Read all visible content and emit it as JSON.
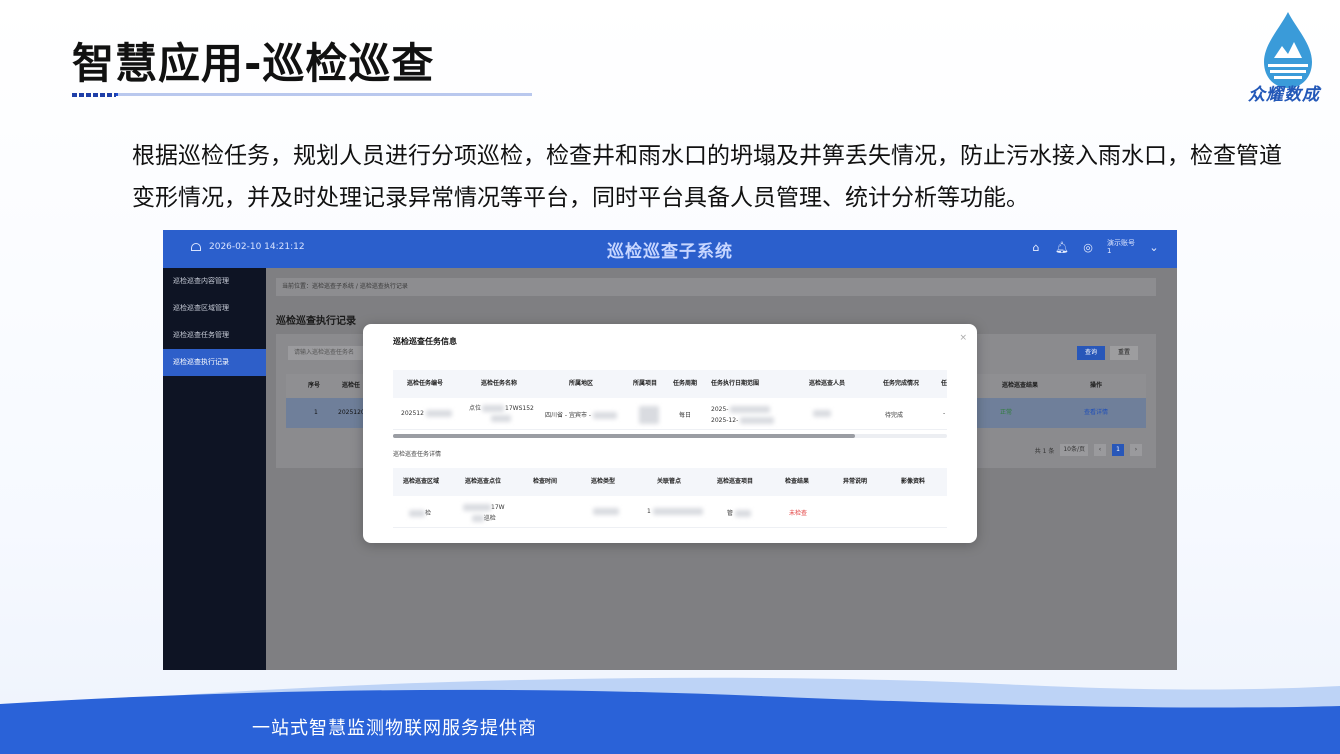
{
  "slide": {
    "title": "智慧应用-巡检巡查",
    "logo_text": "众耀数成",
    "description": "根据巡检任务，规划人员进行分项巡检，检查井和雨水口的坍塌及井箅丢失情况，防止污水接入雨水口，检查管道变形情况，并及时处理记录异常情况等平台，同时平台具备人员管理、统计分析等功能。",
    "footer": "一站式智慧监测物联网服务提供商"
  },
  "app": {
    "header": {
      "datetime": "2026-02-10 14:21:12",
      "title": "巡检巡查子系统",
      "user_name": "演示账号",
      "user_sub": "1",
      "icons": [
        "home-icon",
        "bell-icon",
        "user-avatar-icon",
        "chevron-down-icon"
      ]
    },
    "sidebar": {
      "items": [
        {
          "label": "巡检巡查内容管理"
        },
        {
          "label": "巡检巡查区域管理"
        },
        {
          "label": "巡检巡查任务管理"
        },
        {
          "label": "巡检巡查执行记录"
        }
      ]
    },
    "breadcrumb": "当前位置：巡检巡查子系统 / 巡检巡查执行记录",
    "page_title": "巡检巡查执行记录",
    "search_placeholder": "请输入巡检巡查任务名",
    "query_button": "查询",
    "reset_button": "重置",
    "table": {
      "columns": [
        "序号",
        "巡检任",
        "巡检巡查结果",
        "操作"
      ],
      "row": {
        "index": "1",
        "code": "2025120",
        "result": "正常",
        "action": "查看详情"
      }
    },
    "pager": {
      "total": "共 1 条",
      "page_size": "10条/页",
      "prev": "‹",
      "page": "1",
      "next": "›"
    },
    "modal": {
      "title": "巡检巡查任务信息",
      "close": "×",
      "info_columns": [
        "巡检任务编号",
        "巡检任务名称",
        "所属地区",
        "所属项目",
        "任务周期",
        "任务执行日期范围",
        "巡检巡查人员",
        "任务完成情况",
        "任"
      ],
      "info_row": {
        "code": "202512",
        "name_a": "点位",
        "name_b": "17WS152",
        "region": "四川省 - 宜宾市 -",
        "cycle": "每日",
        "date_a": "2025-",
        "date_b": "2025-12-",
        "status": "待完成",
        "extra": "-"
      },
      "detail_label": "巡检巡查任务详情",
      "detail_columns": [
        "巡检巡查区域",
        "巡检巡查点位",
        "检查时间",
        "巡检类型",
        "关联管点",
        "巡检巡查项目",
        "检查结果",
        "异常说明",
        "影像资料"
      ],
      "detail_row": {
        "area": "检",
        "point_a": "17W",
        "point_b": "巡检",
        "pipe": "1",
        "item": "管",
        "result": "未检查"
      },
      "colors": {
        "result_red": "#e23c3c"
      }
    }
  }
}
